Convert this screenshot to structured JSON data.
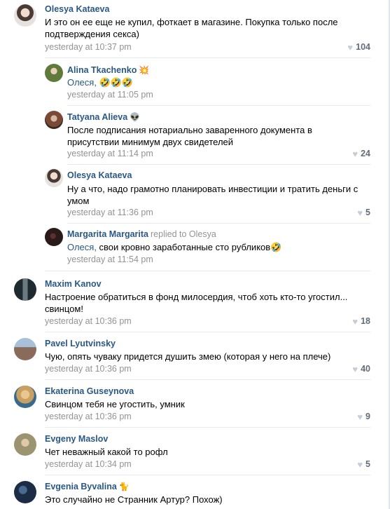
{
  "comments": [
    {
      "author": "Olesya Kataeva",
      "author_emoji": "",
      "replied": "",
      "text": "И это он ее еще не купил, фоткает в магазине. Покупка только после подтверждения секса)",
      "mention": "",
      "time": "yesterday at 10:37 pm",
      "likes": "104",
      "avatar_color": "#d9d3cd"
    },
    {
      "author": "Alina Tkachenko",
      "author_emoji": "💥",
      "replied": "",
      "text": "🤣🤣🤣",
      "mention": "Олеся, ",
      "time": "yesterday at 11:05 pm",
      "likes": "",
      "avatar_color": "#5f7a3a"
    },
    {
      "author": "Tatyana Alieva",
      "author_emoji": "👽",
      "replied": "",
      "text": "После подписания нотариально заваренного документа в присутствии минимум двух свидетелей",
      "mention": "",
      "time": "yesterday at 11:14 pm",
      "likes": "24",
      "avatar_color": "#7a4a36"
    },
    {
      "author": "Olesya Kataeva",
      "author_emoji": "",
      "replied": "",
      "text": "Ну а что, надо грамотно планировать инвестиции и тратить деньги с умом",
      "mention": "",
      "time": "yesterday at 11:36 pm",
      "likes": "5",
      "avatar_color": "#d9d3cd"
    },
    {
      "author": "Margarita Margarita",
      "author_emoji": "",
      "replied": "replied to Olesya",
      "text": "свои кровно заработанные сто рубликов🤣",
      "mention": "Олеся, ",
      "time": "yesterday at 11:54 pm",
      "likes": "",
      "avatar_color": "#2b1a1a"
    },
    {
      "author": "Maxim Kanov",
      "author_emoji": "",
      "replied": "",
      "text": "Настроение обратиться в фонд милосердия, чтоб хоть кто-то угостил... свинцом!",
      "mention": "",
      "time": "yesterday at 10:36 pm",
      "likes": "18",
      "avatar_color": "#3a4a52"
    },
    {
      "author": "Pavel Lyutvinsky",
      "author_emoji": "",
      "replied": "",
      "text": "Чую, опять чуваку придется душить змею (которая у него на плече)",
      "mention": "",
      "time": "yesterday at 10:36 pm",
      "likes": "40",
      "avatar_color": "#8a6a5a"
    },
    {
      "author": "Ekaterina Guseynova",
      "author_emoji": "",
      "replied": "",
      "text": "Свинцом тебя не угостить, умник",
      "mention": "",
      "time": "yesterday at 10:36 pm",
      "likes": "9",
      "avatar_color": "#c9a060"
    },
    {
      "author": "Evgeny Maslov",
      "author_emoji": "",
      "replied": "",
      "text": "Чет неважный какой то рофл",
      "mention": "",
      "time": "yesterday at 10:34 pm",
      "likes": "5",
      "avatar_color": "#9a9470"
    },
    {
      "author": "Evgenia Byvalina",
      "author_emoji": "🐈",
      "replied": "",
      "text": "Это случайно не Странник Артур? Похож)",
      "mention": "",
      "time": "",
      "likes": "",
      "avatar_color": "#1c2c44"
    }
  ]
}
